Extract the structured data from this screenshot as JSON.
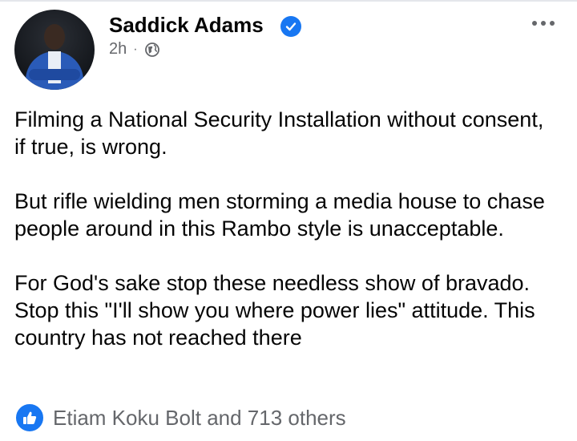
{
  "post": {
    "author": "Saddick Adams",
    "time": "2h",
    "separator": "·",
    "paragraphs": [
      "Filming a National Security Installation without consent, if true, is wrong.",
      "But rifle wielding men storming a media house to chase people around in this Rambo style is unacceptable.",
      "For God's sake stop these needless show of bravado. Stop this \"I'll show you where power lies\" attitude. This country has not reached there"
    ],
    "reactions_text": "Etiam Koku Bolt and 713 others"
  },
  "icons": {
    "verified": "verified-badge-icon",
    "audience": "globe-icon",
    "more": "more-options-icon",
    "like": "like-icon"
  },
  "colors": {
    "accent": "#1877f2",
    "secondary_text": "#65676b",
    "primary_text": "#050505"
  }
}
